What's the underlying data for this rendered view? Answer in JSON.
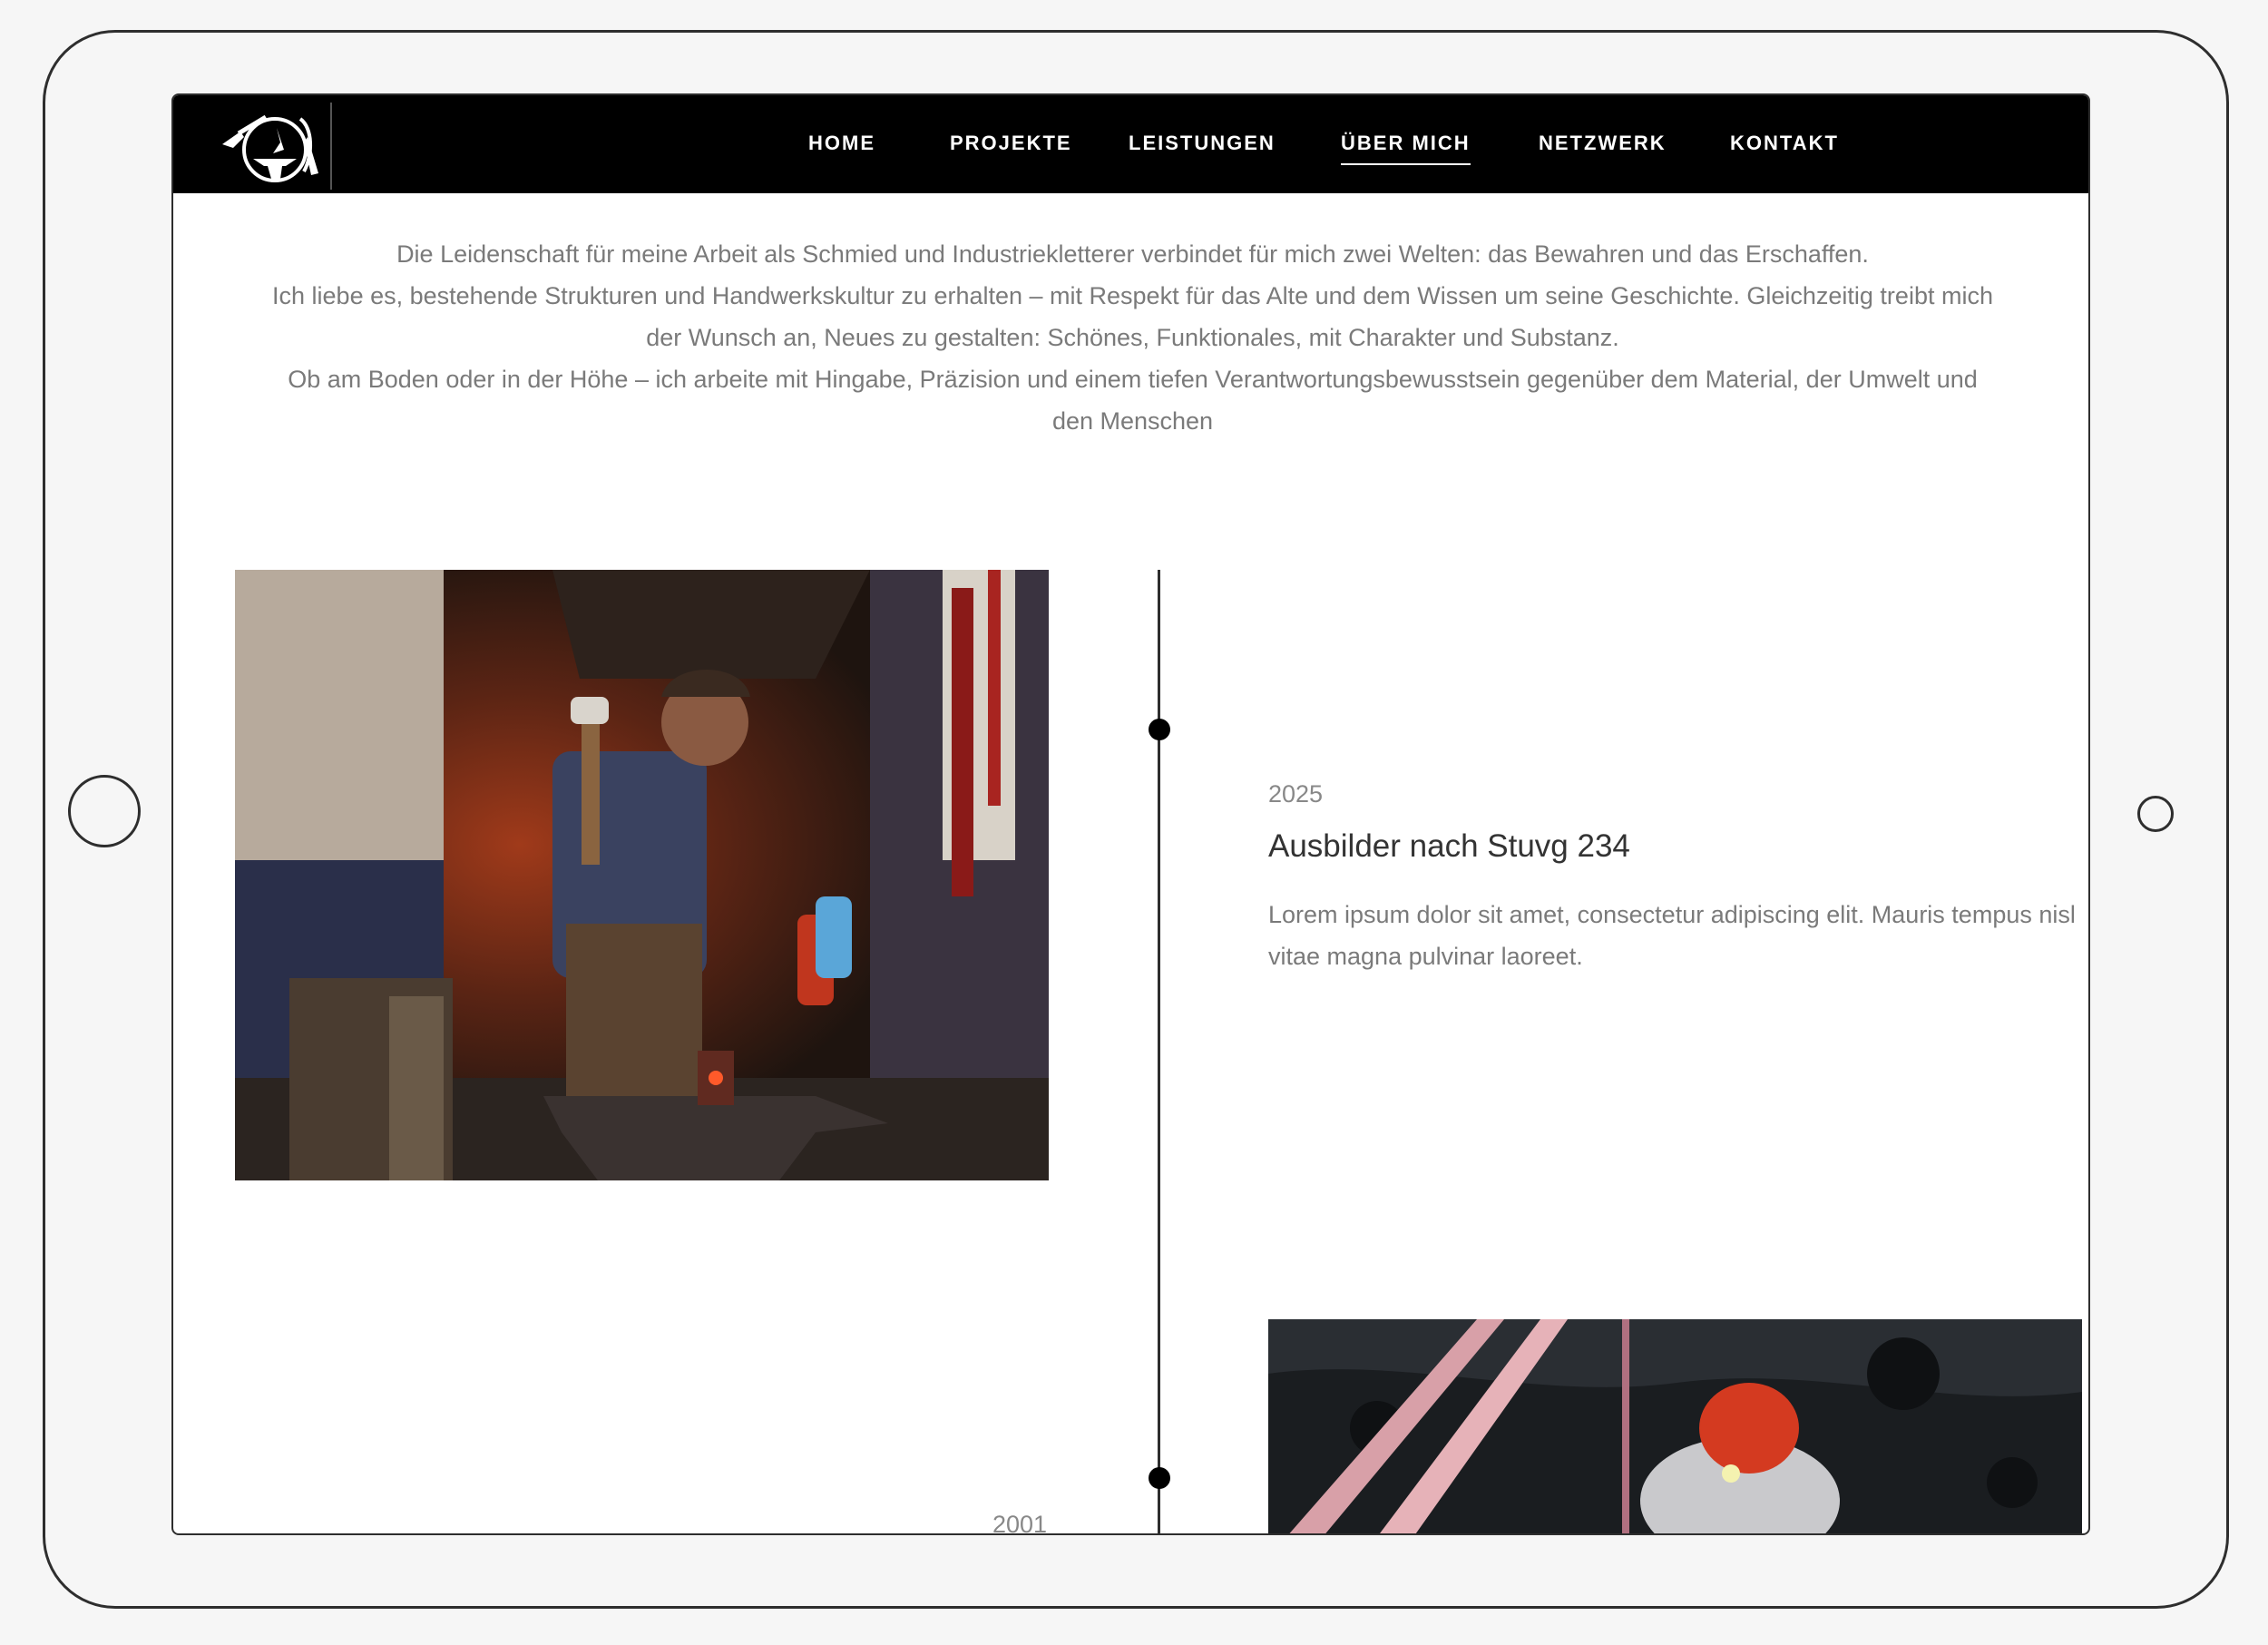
{
  "nav": {
    "items": [
      {
        "label": "HOME"
      },
      {
        "label": "PROJEKTE"
      },
      {
        "label": "LEISTUNGEN"
      },
      {
        "label": "ÜBER MICH",
        "active": true
      },
      {
        "label": "NETZWERK"
      },
      {
        "label": "KONTAKT"
      }
    ]
  },
  "intro": {
    "line1": "Die Leidenschaft für meine Arbeit als Schmied und Industriekletterer verbindet für mich zwei Welten: das Bewahren und das Erschaffen.",
    "line2": "Ich liebe es, bestehende Strukturen und Handwerkskultur zu erhalten – mit Respekt für das Alte und dem Wissen um seine Geschichte. Gleichzeitig treibt mich der Wunsch an, Neues zu gestalten: Schönes, Funktionales, mit Charakter und Substanz.",
    "line3": "Ob am Boden oder in der Höhe – ich arbeite mit Hingabe, Präzision und einem tiefen Verantwortungsbewusstsein gegenüber dem Material, der Umwelt und den Menschen"
  },
  "timeline": {
    "entries": [
      {
        "year": "2025",
        "title": "Ausbilder nach Stuvg 234",
        "description": "Lorem ipsum dolor sit amet, consectetur adipiscing elit. Mauris tempus nisl vitae magna pulvinar laoreet."
      },
      {
        "year": "2001"
      }
    ]
  },
  "colors": {
    "navbar": "#000000",
    "text_muted": "#7a7a7a",
    "text_dark": "#333333",
    "frame": "#2e2e2e"
  }
}
